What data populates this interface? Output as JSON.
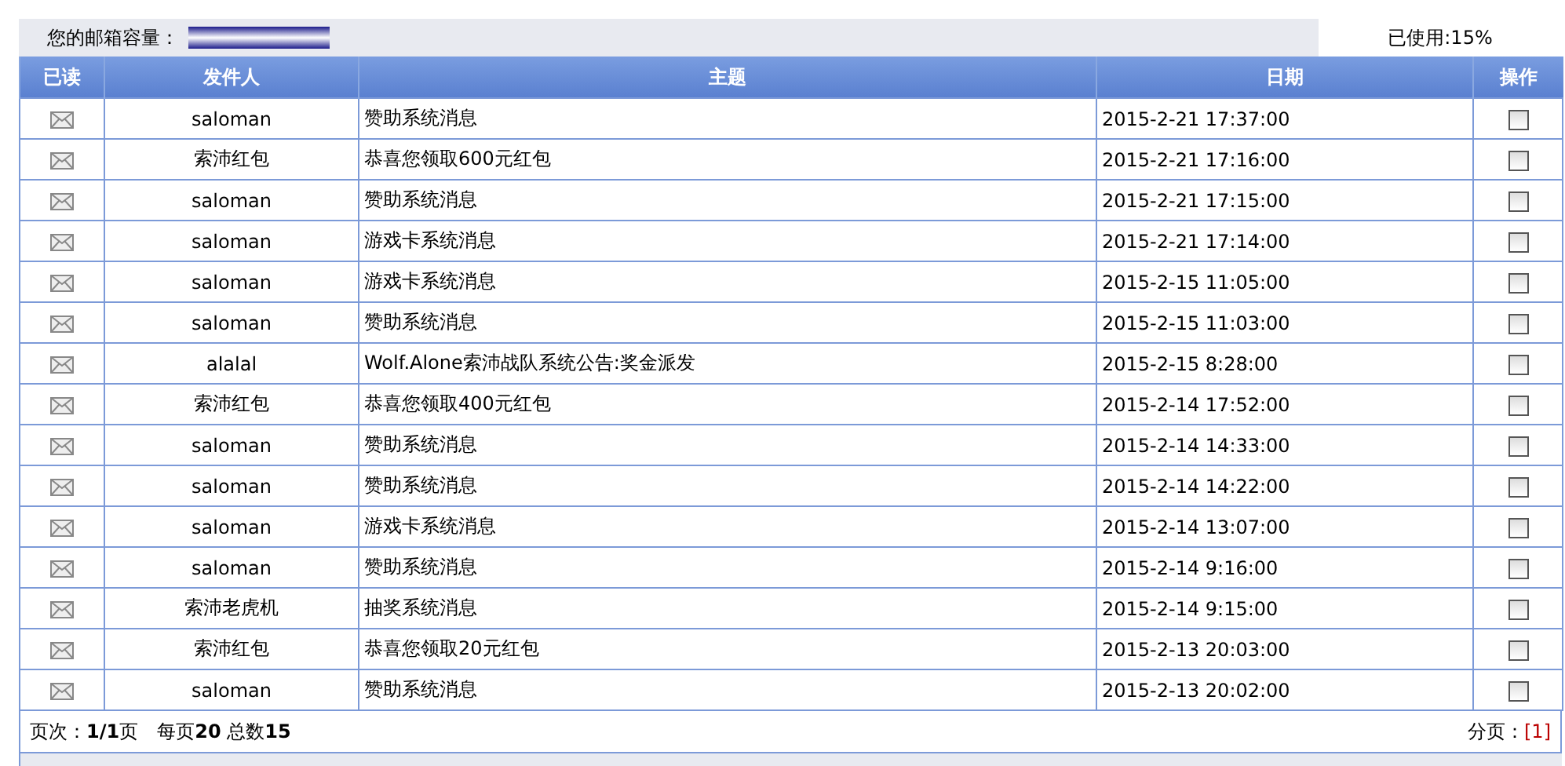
{
  "capacity": {
    "label": "您的邮箱容量：",
    "used": "已使用:15%"
  },
  "columns": [
    "已读",
    "发件人",
    "主题",
    "日期",
    "操作"
  ],
  "rows": [
    {
      "sender": "saloman",
      "subject": "赞助系统消息",
      "date": "2015-2-21 17:37:00",
      "checked": false
    },
    {
      "sender": "索沛红包",
      "subject": "恭喜您领取600元红包",
      "date": "2015-2-21 17:16:00",
      "checked": false
    },
    {
      "sender": "saloman",
      "subject": "赞助系统消息",
      "date": "2015-2-21 17:15:00",
      "checked": false
    },
    {
      "sender": "saloman",
      "subject": "游戏卡系统消息",
      "date": "2015-2-21 17:14:00",
      "checked": false
    },
    {
      "sender": "saloman",
      "subject": "游戏卡系统消息",
      "date": "2015-2-15 11:05:00",
      "checked": false
    },
    {
      "sender": "saloman",
      "subject": "赞助系统消息",
      "date": "2015-2-15 11:03:00",
      "checked": false
    },
    {
      "sender": "alalal",
      "subject": "Wolf.Alone索沛战队系统公告:奖金派发",
      "date": "2015-2-15 8:28:00",
      "checked": false
    },
    {
      "sender": "索沛红包",
      "subject": "恭喜您领取400元红包",
      "date": "2015-2-14 17:52:00",
      "checked": false
    },
    {
      "sender": "saloman",
      "subject": "赞助系统消息",
      "date": "2015-2-14 14:33:00",
      "checked": false
    },
    {
      "sender": "saloman",
      "subject": "赞助系统消息",
      "date": "2015-2-14 14:22:00",
      "checked": false
    },
    {
      "sender": "saloman",
      "subject": "游戏卡系统消息",
      "date": "2015-2-14 13:07:00",
      "checked": false
    },
    {
      "sender": "saloman",
      "subject": "赞助系统消息",
      "date": "2015-2-14 9:16:00",
      "checked": false
    },
    {
      "sender": "索沛老虎机",
      "subject": "抽奖系统消息",
      "date": "2015-2-14 9:15:00",
      "checked": false
    },
    {
      "sender": "索沛红包",
      "subject": "恭喜您领取20元红包",
      "date": "2015-2-13 20:03:00",
      "checked": false
    },
    {
      "sender": "saloman",
      "subject": "赞助系统消息",
      "date": "2015-2-13 20:02:00",
      "checked": false
    }
  ],
  "footer": {
    "summary": "页次：**1/1**页　每页**20** 总数**15**",
    "pages_label": "分页：",
    "page_link": "[1]"
  }
}
